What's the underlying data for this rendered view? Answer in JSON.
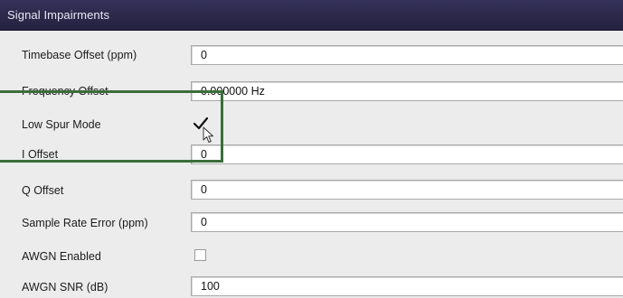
{
  "panel": {
    "title": "Signal Impairments"
  },
  "rows": [
    {
      "label": "Timebase Offset (ppm)",
      "value": "0",
      "type": "text"
    },
    {
      "label": "Frequency Offset",
      "value": "0.000000 Hz",
      "type": "text"
    },
    {
      "label": "Low Spur Mode",
      "checked": true,
      "type": "checkbox"
    },
    {
      "label": "I Offset",
      "value": "0",
      "type": "text"
    },
    {
      "label": "Q Offset",
      "value": "0",
      "type": "text"
    },
    {
      "label": "Sample Rate Error (ppm)",
      "value": "0",
      "type": "text"
    },
    {
      "label": "AWGN Enabled",
      "checked": false,
      "type": "checkbox"
    },
    {
      "label": "AWGN SNR (dB)",
      "value": "100",
      "type": "text"
    }
  ],
  "colors": {
    "titlebar": "#2b2748",
    "highlight": "#3a6e3a",
    "background": "#ececec"
  },
  "icons": {
    "check": "checkmark-icon",
    "cursor": "mouse-pointer-icon"
  }
}
